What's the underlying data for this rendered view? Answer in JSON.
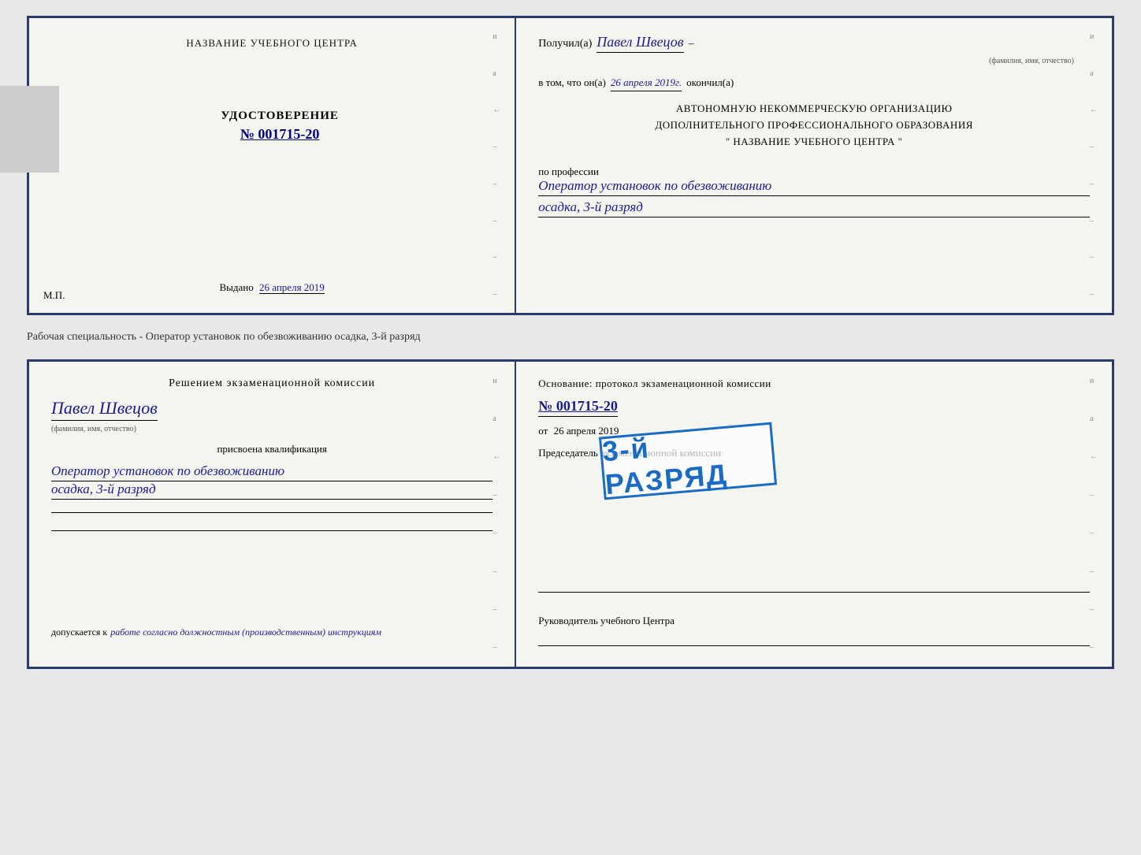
{
  "top_doc": {
    "left": {
      "institution_title": "НАЗВАНИЕ УЧЕБНОГО ЦЕНТРА",
      "cert_type": "УДОСТОВЕРЕНИЕ",
      "cert_number": "№ 001715-20",
      "issued_label": "Выдано",
      "issued_date": "26 апреля 2019",
      "mp_label": "М.П."
    },
    "right": {
      "received_label": "Получил(а)",
      "received_name": "Павел Швецов",
      "fio_label": "(фамилия, имя, отчество)",
      "completed_prefix": "в том, что он(а)",
      "completed_date": "26 апреля 2019г.",
      "completed_suffix": "окончил(а)",
      "org_line1": "АВТОНОМНУЮ НЕКОММЕРЧЕСКУЮ ОРГАНИЗАЦИЮ",
      "org_line2": "ДОПОЛНИТЕЛЬНОГО ПРОФЕССИОНАЛЬНОГО ОБРАЗОВАНИЯ",
      "org_line3": "\"   НАЗВАНИЕ УЧЕБНОГО ЦЕНТРА   \"",
      "profession_label": "по профессии",
      "profession_value": "Оператор установок по обезвоживанию",
      "rank_value": "осадка, 3-й разряд"
    }
  },
  "between": {
    "text": "Рабочая специальность - Оператор установок по обезвоживанию осадка, 3-й разряд"
  },
  "bottom_doc": {
    "left": {
      "decision_title": "Решением экзаменационной комиссии",
      "person_name": "Павел Швецов",
      "fio_label": "(фамилия, имя, отчество)",
      "qualification_label": "присвоена квалификация",
      "qualification_value": "Оператор установок по обезвоживанию",
      "rank_value": "осадка, 3-й разряд",
      "allowed_prefix": "допускается к",
      "allowed_italic": "работе согласно должностным (производственным) инструкциям"
    },
    "right": {
      "basis_title": "Основание: протокол экзаменационной комиссии",
      "protocol_number": "№  001715-20",
      "from_prefix": "от",
      "from_date": "26 апреля 2019",
      "chairman_label": "Председатель экзаменационной комиссии",
      "stamp_text": "3-й РАЗРЯД",
      "director_label": "Руководитель учебного Центра"
    }
  },
  "side_marks": [
    "и",
    "а",
    "←",
    "–",
    "–",
    "–",
    "–",
    "–"
  ],
  "side_marks_bottom": [
    "и",
    "а",
    "←",
    "–",
    "–",
    "–",
    "–",
    "–"
  ]
}
